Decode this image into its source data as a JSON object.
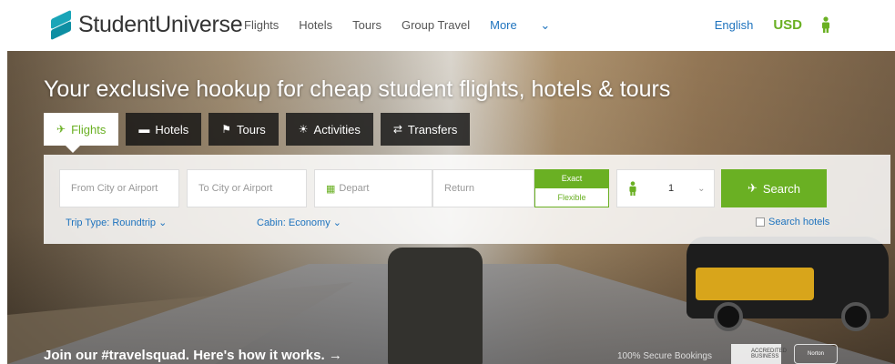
{
  "brand": {
    "name": "StudentUniverse"
  },
  "nav": {
    "items": [
      "Flights",
      "Hotels",
      "Tours",
      "Group Travel"
    ],
    "more": "More"
  },
  "header": {
    "language": "English",
    "currency": "USD"
  },
  "hero": {
    "headline": "Your exclusive hookup for cheap student flights, hotels & tours",
    "join_text": "Join our #travelsquad. Here's how it works. →",
    "secure_text": "100% Secure Bookings",
    "badges": [
      "ACCREDITED BUSINESS",
      "Norton"
    ]
  },
  "tabs": [
    {
      "label": "Flights",
      "icon": "plane-icon",
      "active": true
    },
    {
      "label": "Hotels",
      "icon": "bed-icon",
      "active": false
    },
    {
      "label": "Tours",
      "icon": "flag-icon",
      "active": false
    },
    {
      "label": "Activities",
      "icon": "sun-icon",
      "active": false
    },
    {
      "label": "Transfers",
      "icon": "transfer-icon",
      "active": false
    }
  ],
  "search": {
    "from_placeholder": "From City or Airport",
    "to_placeholder": "To City or Airport",
    "depart_placeholder": "Depart",
    "return_placeholder": "Return",
    "exact_label": "Exact",
    "flexible_label": "Flexible",
    "passengers": "1",
    "search_label": "Search",
    "trip_type": "Trip Type: Roundtrip",
    "cabin": "Cabin: Economy",
    "search_hotels": "Search hotels"
  },
  "colors": {
    "accent": "#6ab023",
    "link": "#1e73be",
    "brand": "#1aa5b8"
  }
}
